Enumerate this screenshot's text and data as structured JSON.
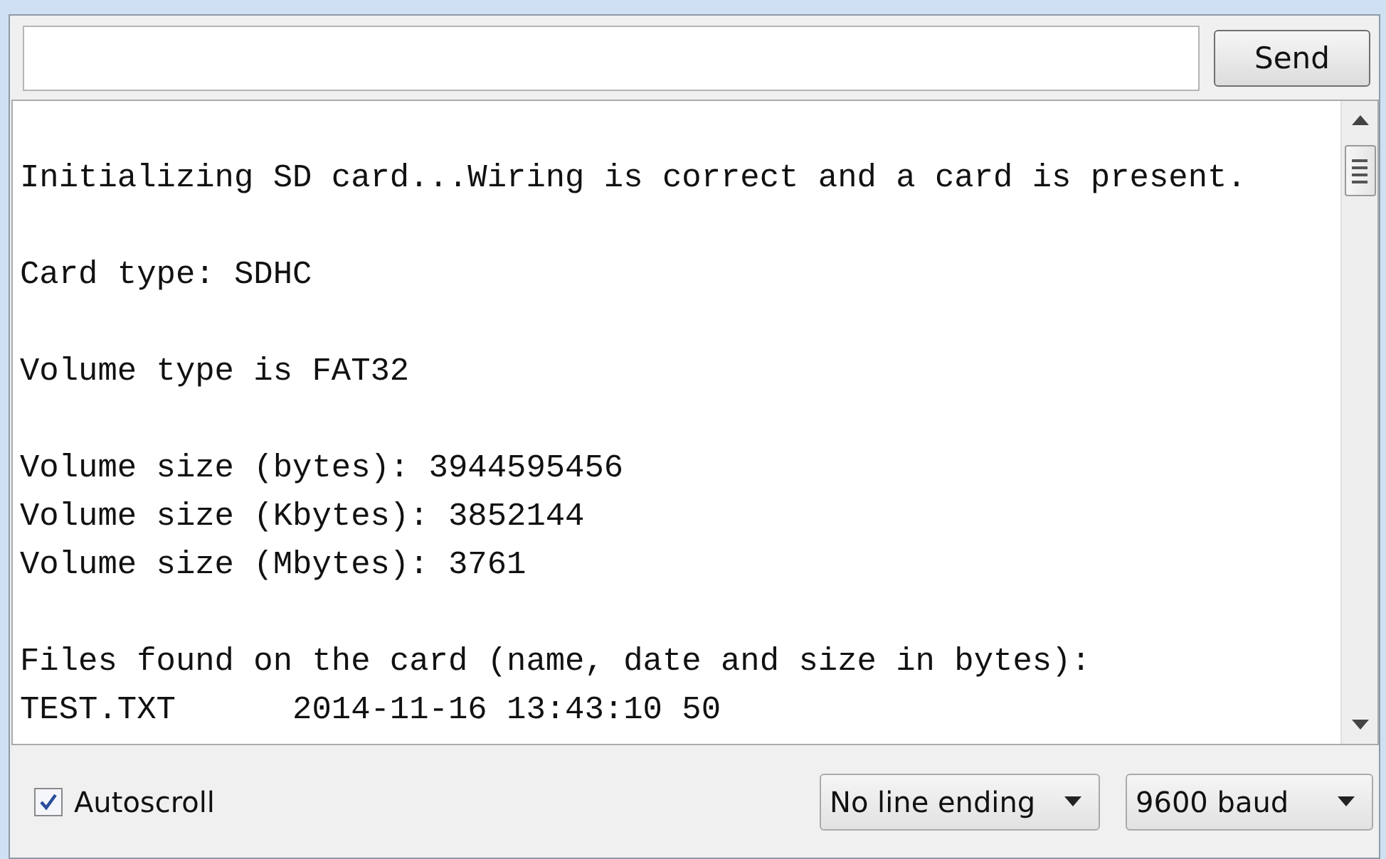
{
  "send_button": "Send",
  "output": [
    [
      "Initializing SD card...Wiring is correct and a card is present."
    ],
    [
      "Card type: SDHC"
    ],
    [
      "Volume type is FAT32"
    ],
    [
      "Volume size (bytes): 3944595456",
      "Volume size (Kbytes): 3852144",
      "Volume size (Mbytes): 3761"
    ],
    [
      "Files found on the card (name, date and size in bytes):",
      "TEST.TXT      2014-11-16 13:43:10 50"
    ]
  ],
  "autoscroll": {
    "label": "Autoscroll",
    "checked": true
  },
  "line_ending": "No line ending",
  "baud_rate": "9600 baud"
}
